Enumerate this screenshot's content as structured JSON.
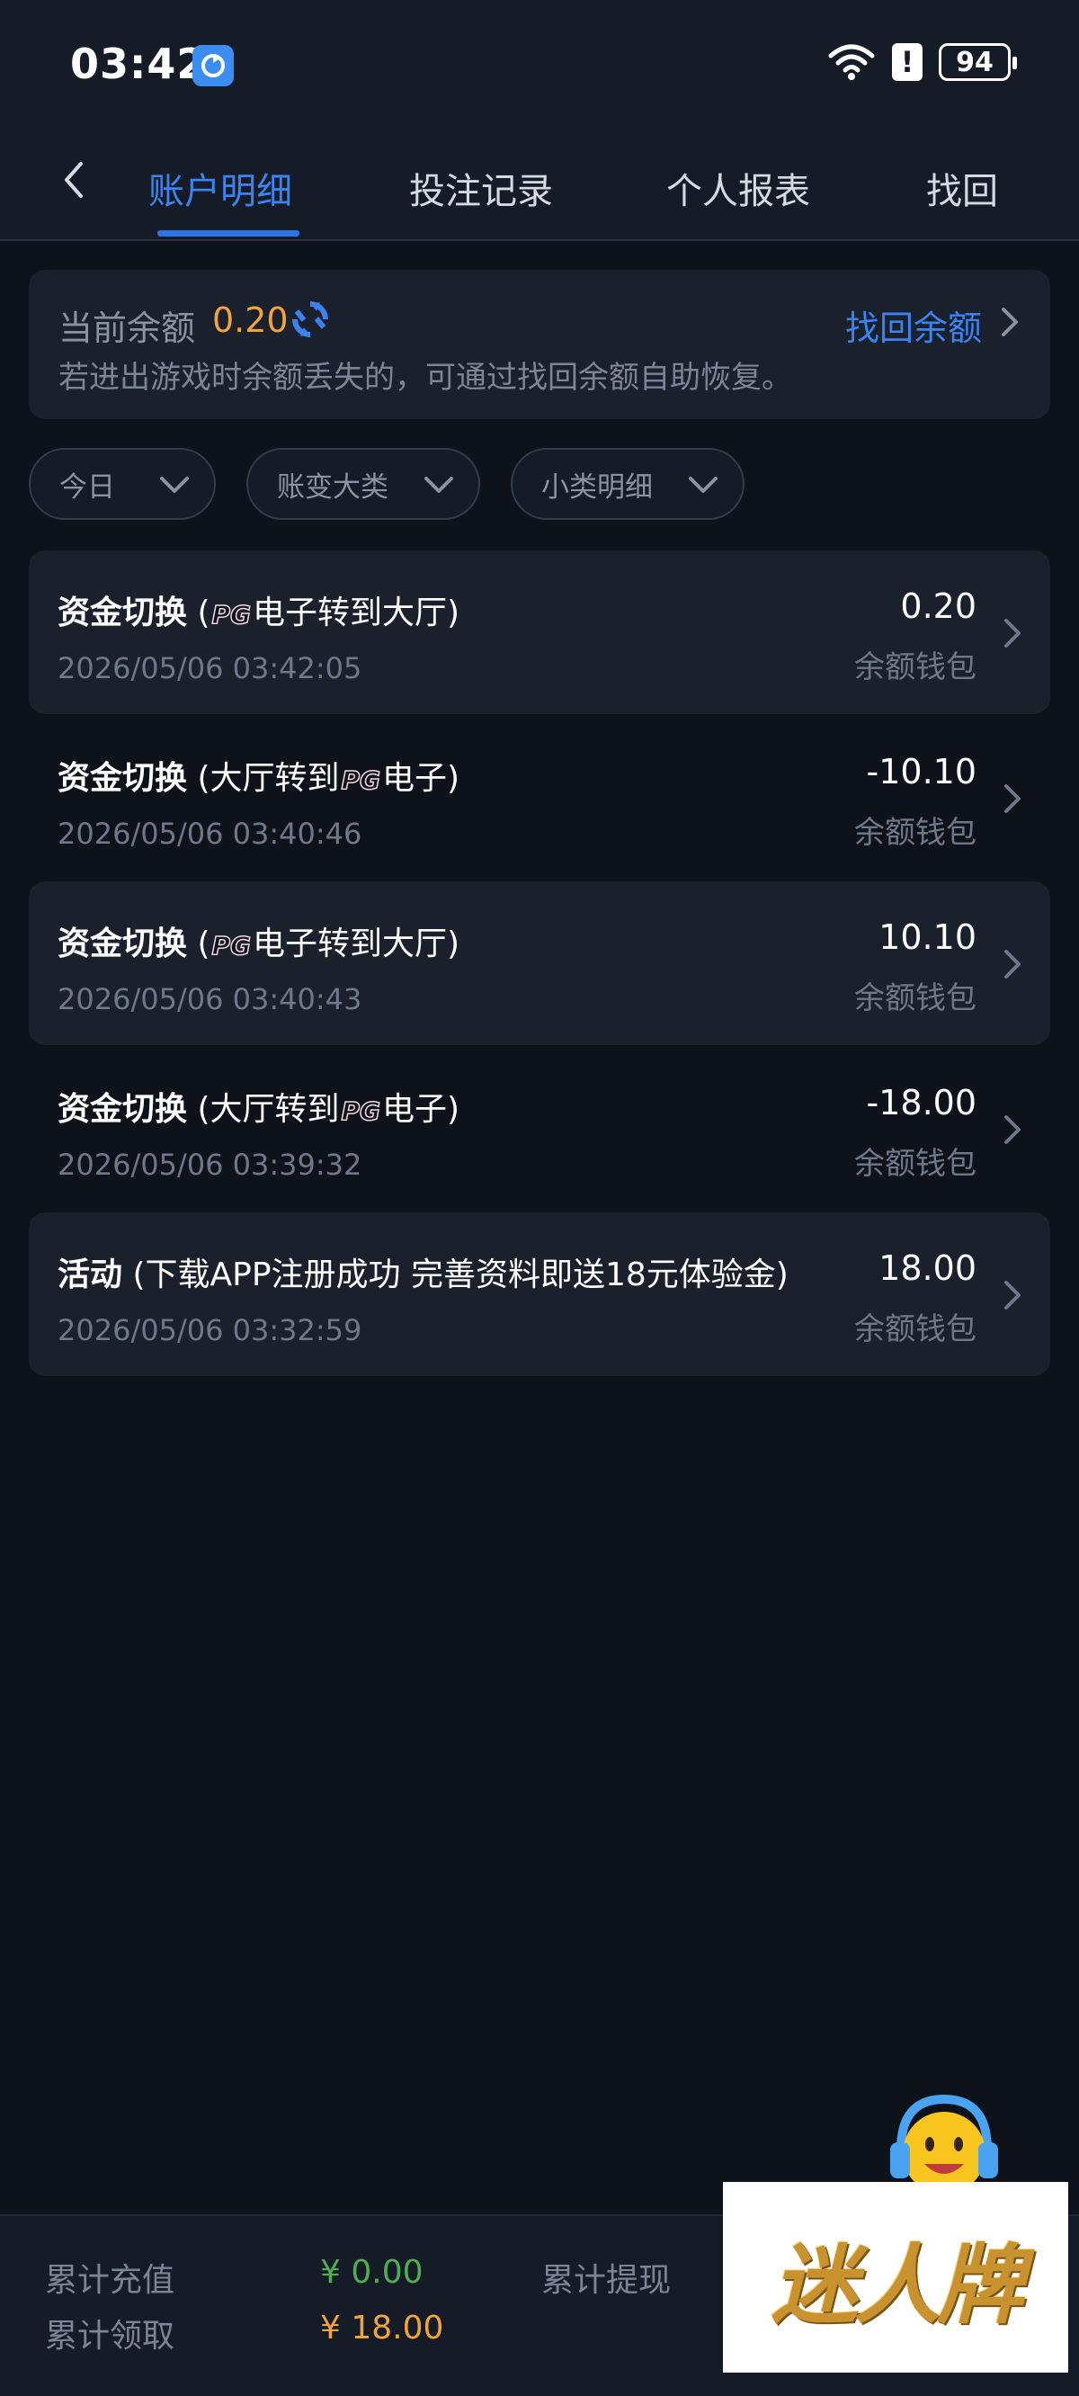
{
  "status_bar": {
    "time": "03:42",
    "battery": "94"
  },
  "tabs": [
    {
      "label": "账户明细",
      "active": true
    },
    {
      "label": "投注记录",
      "active": false
    },
    {
      "label": "个人报表",
      "active": false
    },
    {
      "label": "找回",
      "active": false
    }
  ],
  "balance": {
    "label": "当前余额",
    "value": "0.20",
    "note": "若进出游戏时余额丢失的，可通过找回余额自助恢复。",
    "recover_label": "找回余额"
  },
  "filters": [
    {
      "label": "今日"
    },
    {
      "label": "账变大类"
    },
    {
      "label": "小类明细"
    }
  ],
  "records": [
    {
      "type": "资金切换",
      "detail_before": " (",
      "detail_logo": "PG",
      "detail_after": "电子转到大厅)",
      "logo_first": true,
      "time": "2026/05/06 03:42:05",
      "amount": "0.20",
      "wallet": "余额钱包"
    },
    {
      "type": "资金切换",
      "detail_before": " (大厅转到",
      "detail_logo": "PG",
      "detail_after": "电子)",
      "logo_first": false,
      "time": "2026/05/06 03:40:46",
      "amount": "-10.10",
      "wallet": "余额钱包"
    },
    {
      "type": "资金切换",
      "detail_before": " (",
      "detail_logo": "PG",
      "detail_after": "电子转到大厅)",
      "logo_first": true,
      "time": "2026/05/06 03:40:43",
      "amount": "10.10",
      "wallet": "余额钱包"
    },
    {
      "type": "资金切换",
      "detail_before": " (大厅转到",
      "detail_logo": "PG",
      "detail_after": "电子)",
      "logo_first": false,
      "time": "2026/05/06 03:39:32",
      "amount": "-18.00",
      "wallet": "余额钱包"
    },
    {
      "type": "活动",
      "detail_before": " (下载APP注册成功 完善资料即送18元体验金)",
      "detail_logo": "",
      "detail_after": "",
      "logo_first": false,
      "time": "2026/05/06 03:32:59",
      "amount": "18.00",
      "wallet": "余额钱包"
    }
  ],
  "summary": {
    "deposit_label": "累计充值",
    "deposit_value": "¥ 0.00",
    "withdraw_label": "累计提现",
    "claimed_label": "累计领取",
    "claimed_value": "¥ 18.00"
  },
  "watermark": "迷人牌",
  "colors": {
    "accent": "#3b83f0",
    "balance": "#f2a43a",
    "deposit": "#4caf50",
    "claimed": "#f2a43a"
  }
}
